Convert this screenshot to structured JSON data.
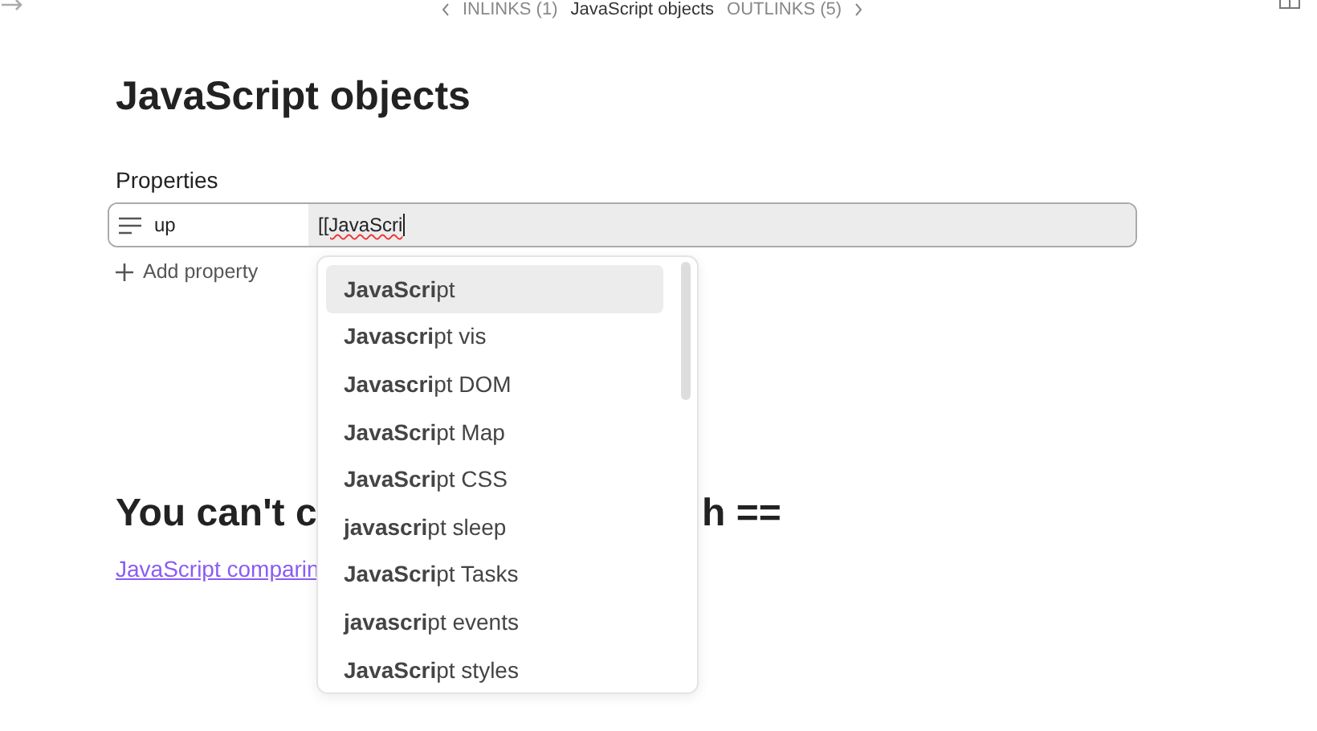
{
  "top_bar": {
    "inlinks": "INLINKS (1)",
    "title": "JavaScript objects",
    "outlinks": "OUTLINKS (5)"
  },
  "page_title": "JavaScript objects",
  "properties": {
    "label": "Properties",
    "items": [
      {
        "key": "up",
        "value": "[[JavaScri"
      }
    ],
    "add": "Add property"
  },
  "suggestions": [
    {
      "text": "**JavaScri**pt",
      "selected": true
    },
    {
      "text": "**Javascri**pt vis",
      "selected": false
    },
    {
      "text": "**Javascri**pt DOM",
      "selected": false
    },
    {
      "text": "**JavaScri**pt Map",
      "selected": false
    },
    {
      "text": "**JavaScri**pt CSS",
      "selected": false
    },
    {
      "text": "**javascri**pt sleep",
      "selected": false
    },
    {
      "text": "**JavaScri**pt Tasks",
      "selected": false
    },
    {
      "text": "**javascri**pt events",
      "selected": false
    },
    {
      "text": "**JavaScri**pt styles",
      "selected": false
    }
  ],
  "heading_parts": [
    "You can't c",
    "h =="
  ],
  "link": "JavaScript comparin"
}
